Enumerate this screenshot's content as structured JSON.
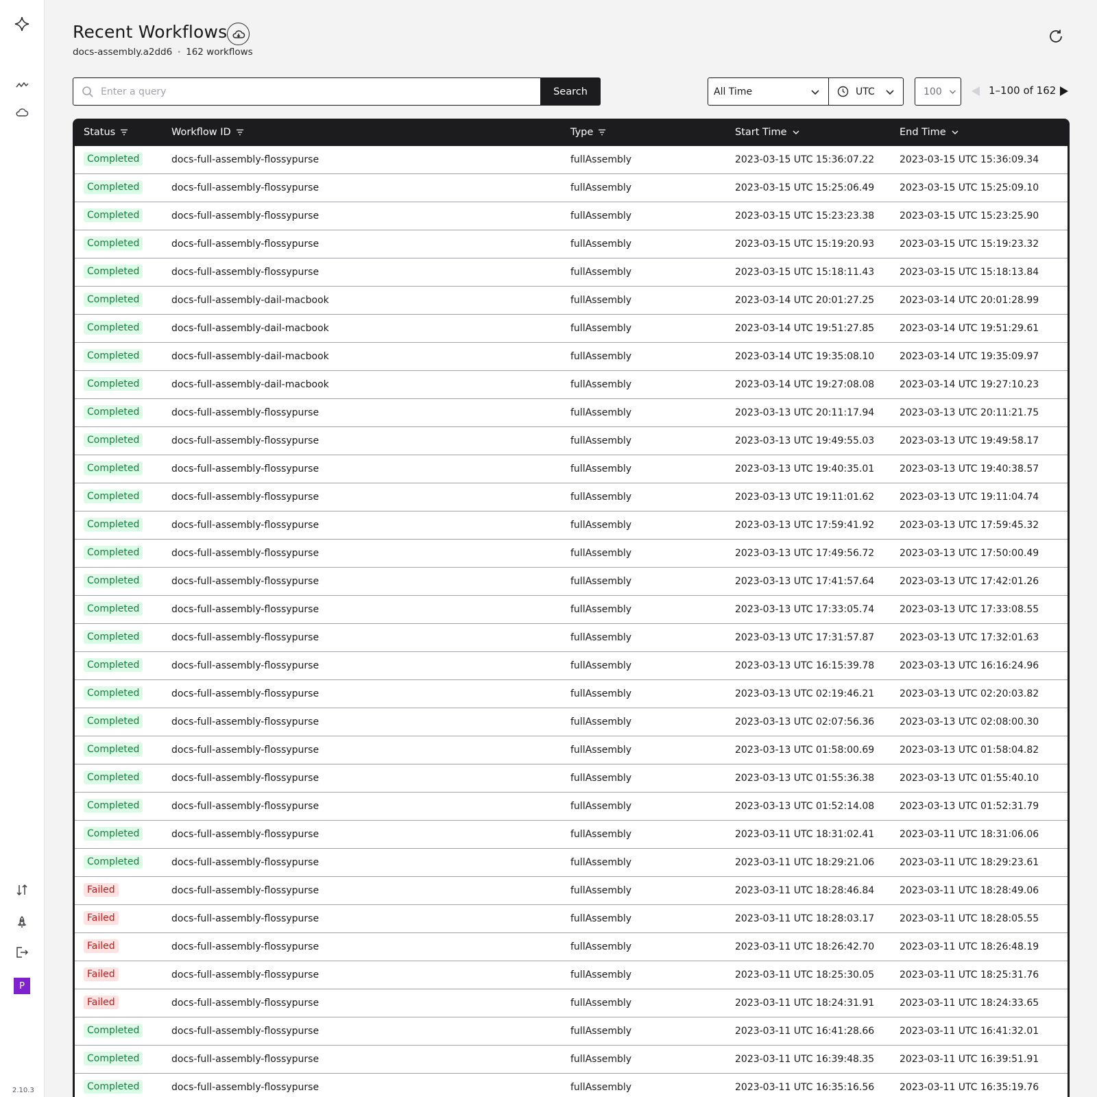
{
  "sidebar": {
    "icons": [
      "logo-icon",
      "activity-icon",
      "cloud-icon",
      "sort-icon",
      "rocket-icon",
      "logout-icon"
    ],
    "avatar_letter": "P",
    "version": "2.10.3"
  },
  "header": {
    "title": "Recent Workflows",
    "namespace": "docs-assembly.a2dd6",
    "separator": "•",
    "count": "162 workflows"
  },
  "search": {
    "placeholder": "Enter a query",
    "button_label": "Search"
  },
  "filters": {
    "time_range": "All Time",
    "timezone": "UTC",
    "page_size": "100"
  },
  "pagination": {
    "info": "1–100 of 162"
  },
  "table": {
    "columns": [
      "Status",
      "Workflow ID",
      "Type",
      "Start Time",
      "End Time"
    ],
    "rows": [
      {
        "status": "Completed",
        "id": "docs-full-assembly-flossypurse",
        "type": "fullAssembly",
        "start": "2023-03-15 UTC 15:36:07.22",
        "end": "2023-03-15 UTC 15:36:09.34"
      },
      {
        "status": "Completed",
        "id": "docs-full-assembly-flossypurse",
        "type": "fullAssembly",
        "start": "2023-03-15 UTC 15:25:06.49",
        "end": "2023-03-15 UTC 15:25:09.10"
      },
      {
        "status": "Completed",
        "id": "docs-full-assembly-flossypurse",
        "type": "fullAssembly",
        "start": "2023-03-15 UTC 15:23:23.38",
        "end": "2023-03-15 UTC 15:23:25.90"
      },
      {
        "status": "Completed",
        "id": "docs-full-assembly-flossypurse",
        "type": "fullAssembly",
        "start": "2023-03-15 UTC 15:19:20.93",
        "end": "2023-03-15 UTC 15:19:23.32"
      },
      {
        "status": "Completed",
        "id": "docs-full-assembly-flossypurse",
        "type": "fullAssembly",
        "start": "2023-03-15 UTC 15:18:11.43",
        "end": "2023-03-15 UTC 15:18:13.84"
      },
      {
        "status": "Completed",
        "id": "docs-full-assembly-dail-macbook",
        "type": "fullAssembly",
        "start": "2023-03-14 UTC 20:01:27.25",
        "end": "2023-03-14 UTC 20:01:28.99"
      },
      {
        "status": "Completed",
        "id": "docs-full-assembly-dail-macbook",
        "type": "fullAssembly",
        "start": "2023-03-14 UTC 19:51:27.85",
        "end": "2023-03-14 UTC 19:51:29.61"
      },
      {
        "status": "Completed",
        "id": "docs-full-assembly-dail-macbook",
        "type": "fullAssembly",
        "start": "2023-03-14 UTC 19:35:08.10",
        "end": "2023-03-14 UTC 19:35:09.97"
      },
      {
        "status": "Completed",
        "id": "docs-full-assembly-dail-macbook",
        "type": "fullAssembly",
        "start": "2023-03-14 UTC 19:27:08.08",
        "end": "2023-03-14 UTC 19:27:10.23"
      },
      {
        "status": "Completed",
        "id": "docs-full-assembly-flossypurse",
        "type": "fullAssembly",
        "start": "2023-03-13 UTC 20:11:17.94",
        "end": "2023-03-13 UTC 20:11:21.75"
      },
      {
        "status": "Completed",
        "id": "docs-full-assembly-flossypurse",
        "type": "fullAssembly",
        "start": "2023-03-13 UTC 19:49:55.03",
        "end": "2023-03-13 UTC 19:49:58.17"
      },
      {
        "status": "Completed",
        "id": "docs-full-assembly-flossypurse",
        "type": "fullAssembly",
        "start": "2023-03-13 UTC 19:40:35.01",
        "end": "2023-03-13 UTC 19:40:38.57"
      },
      {
        "status": "Completed",
        "id": "docs-full-assembly-flossypurse",
        "type": "fullAssembly",
        "start": "2023-03-13 UTC 19:11:01.62",
        "end": "2023-03-13 UTC 19:11:04.74"
      },
      {
        "status": "Completed",
        "id": "docs-full-assembly-flossypurse",
        "type": "fullAssembly",
        "start": "2023-03-13 UTC 17:59:41.92",
        "end": "2023-03-13 UTC 17:59:45.32"
      },
      {
        "status": "Completed",
        "id": "docs-full-assembly-flossypurse",
        "type": "fullAssembly",
        "start": "2023-03-13 UTC 17:49:56.72",
        "end": "2023-03-13 UTC 17:50:00.49"
      },
      {
        "status": "Completed",
        "id": "docs-full-assembly-flossypurse",
        "type": "fullAssembly",
        "start": "2023-03-13 UTC 17:41:57.64",
        "end": "2023-03-13 UTC 17:42:01.26"
      },
      {
        "status": "Completed",
        "id": "docs-full-assembly-flossypurse",
        "type": "fullAssembly",
        "start": "2023-03-13 UTC 17:33:05.74",
        "end": "2023-03-13 UTC 17:33:08.55"
      },
      {
        "status": "Completed",
        "id": "docs-full-assembly-flossypurse",
        "type": "fullAssembly",
        "start": "2023-03-13 UTC 17:31:57.87",
        "end": "2023-03-13 UTC 17:32:01.63"
      },
      {
        "status": "Completed",
        "id": "docs-full-assembly-flossypurse",
        "type": "fullAssembly",
        "start": "2023-03-13 UTC 16:15:39.78",
        "end": "2023-03-13 UTC 16:16:24.96"
      },
      {
        "status": "Completed",
        "id": "docs-full-assembly-flossypurse",
        "type": "fullAssembly",
        "start": "2023-03-13 UTC 02:19:46.21",
        "end": "2023-03-13 UTC 02:20:03.82"
      },
      {
        "status": "Completed",
        "id": "docs-full-assembly-flossypurse",
        "type": "fullAssembly",
        "start": "2023-03-13 UTC 02:07:56.36",
        "end": "2023-03-13 UTC 02:08:00.30"
      },
      {
        "status": "Completed",
        "id": "docs-full-assembly-flossypurse",
        "type": "fullAssembly",
        "start": "2023-03-13 UTC 01:58:00.69",
        "end": "2023-03-13 UTC 01:58:04.82"
      },
      {
        "status": "Completed",
        "id": "docs-full-assembly-flossypurse",
        "type": "fullAssembly",
        "start": "2023-03-13 UTC 01:55:36.38",
        "end": "2023-03-13 UTC 01:55:40.10"
      },
      {
        "status": "Completed",
        "id": "docs-full-assembly-flossypurse",
        "type": "fullAssembly",
        "start": "2023-03-13 UTC 01:52:14.08",
        "end": "2023-03-13 UTC 01:52:31.79"
      },
      {
        "status": "Completed",
        "id": "docs-full-assembly-flossypurse",
        "type": "fullAssembly",
        "start": "2023-03-11 UTC 18:31:02.41",
        "end": "2023-03-11 UTC 18:31:06.06"
      },
      {
        "status": "Completed",
        "id": "docs-full-assembly-flossypurse",
        "type": "fullAssembly",
        "start": "2023-03-11 UTC 18:29:21.06",
        "end": "2023-03-11 UTC 18:29:23.61"
      },
      {
        "status": "Failed",
        "id": "docs-full-assembly-flossypurse",
        "type": "fullAssembly",
        "start": "2023-03-11 UTC 18:28:46.84",
        "end": "2023-03-11 UTC 18:28:49.06"
      },
      {
        "status": "Failed",
        "id": "docs-full-assembly-flossypurse",
        "type": "fullAssembly",
        "start": "2023-03-11 UTC 18:28:03.17",
        "end": "2023-03-11 UTC 18:28:05.55"
      },
      {
        "status": "Failed",
        "id": "docs-full-assembly-flossypurse",
        "type": "fullAssembly",
        "start": "2023-03-11 UTC 18:26:42.70",
        "end": "2023-03-11 UTC 18:26:48.19"
      },
      {
        "status": "Failed",
        "id": "docs-full-assembly-flossypurse",
        "type": "fullAssembly",
        "start": "2023-03-11 UTC 18:25:30.05",
        "end": "2023-03-11 UTC 18:25:31.76"
      },
      {
        "status": "Failed",
        "id": "docs-full-assembly-flossypurse",
        "type": "fullAssembly",
        "start": "2023-03-11 UTC 18:24:31.91",
        "end": "2023-03-11 UTC 18:24:33.65"
      },
      {
        "status": "Completed",
        "id": "docs-full-assembly-flossypurse",
        "type": "fullAssembly",
        "start": "2023-03-11 UTC 16:41:28.66",
        "end": "2023-03-11 UTC 16:41:32.01"
      },
      {
        "status": "Completed",
        "id": "docs-full-assembly-flossypurse",
        "type": "fullAssembly",
        "start": "2023-03-11 UTC 16:39:48.35",
        "end": "2023-03-11 UTC 16:39:51.91"
      },
      {
        "status": "Completed",
        "id": "docs-full-assembly-flossypurse",
        "type": "fullAssembly",
        "start": "2023-03-11 UTC 16:35:16.56",
        "end": "2023-03-11 UTC 16:35:19.76"
      }
    ]
  },
  "colors": {
    "completed_bg": "#dcfce7",
    "completed_fg": "#15803d",
    "failed_bg": "#fee2e2",
    "failed_fg": "#b91c1c",
    "header_bg": "#1c1c1f",
    "avatar_bg": "#7e22ce"
  }
}
